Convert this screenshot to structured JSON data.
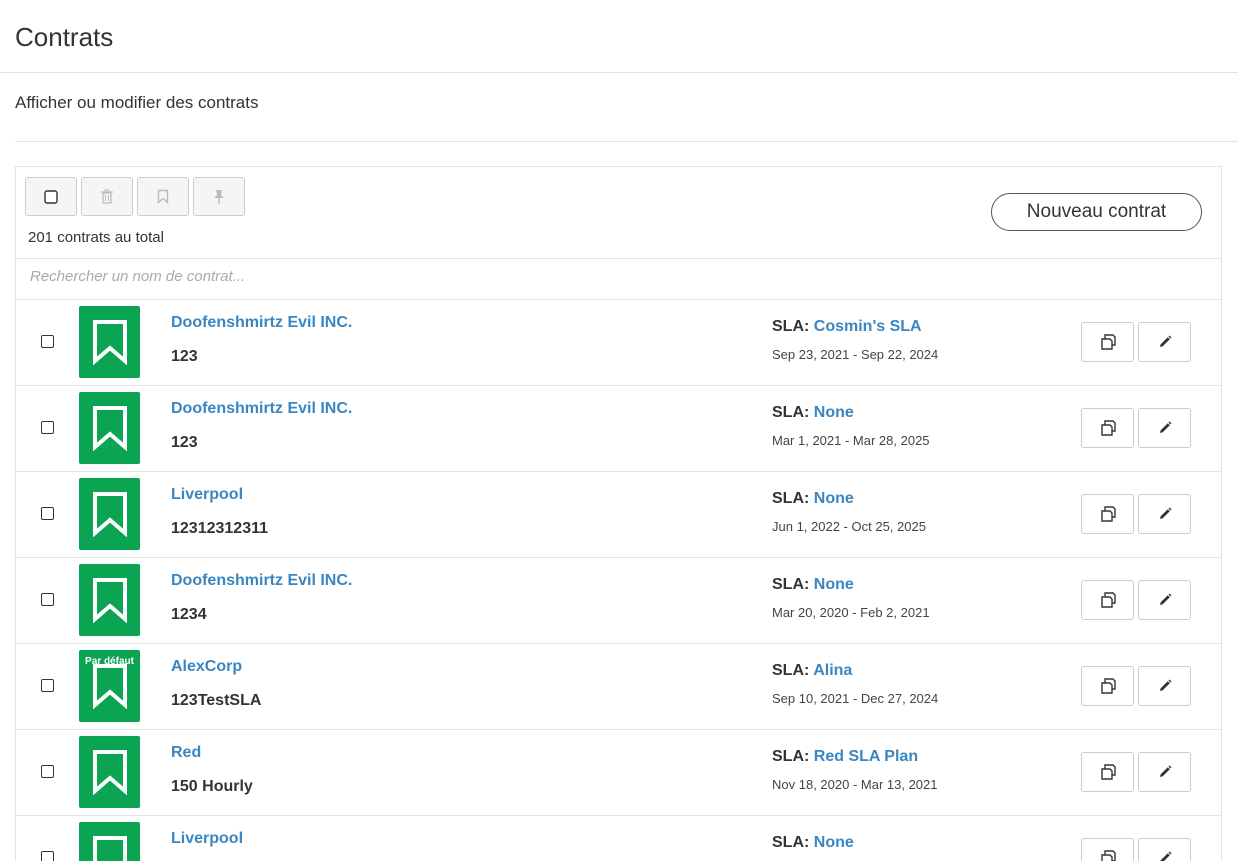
{
  "page": {
    "title": "Contrats",
    "subtitle": "Afficher ou modifier des contrats"
  },
  "toolbar": {
    "total_label": "201 contrats au total",
    "new_button_label": "Nouveau contrat",
    "icons": [
      "checkbox-icon",
      "trash-icon",
      "bookmark-icon",
      "pin-icon"
    ]
  },
  "search": {
    "placeholder": "Rechercher un nom de contrat..."
  },
  "colors": {
    "tile_green": "#0aa453",
    "link_blue": "#3a86c2"
  },
  "contracts": [
    {
      "name": "Doofenshmirtz Evil INC.",
      "code": "123",
      "sla_label": "SLA:",
      "sla_name": "Cosmin's SLA",
      "dates": "Sep 23, 2021 - Sep 22, 2024",
      "badge": ""
    },
    {
      "name": "Doofenshmirtz Evil INC.",
      "code": "123",
      "sla_label": "SLA:",
      "sla_name": "None",
      "dates": "Mar 1, 2021 - Mar 28, 2025",
      "badge": ""
    },
    {
      "name": "Liverpool",
      "code": "12312312311",
      "sla_label": "SLA:",
      "sla_name": "None",
      "dates": "Jun 1, 2022 - Oct 25, 2025",
      "badge": ""
    },
    {
      "name": "Doofenshmirtz Evil INC.",
      "code": "1234",
      "sla_label": "SLA:",
      "sla_name": "None",
      "dates": "Mar 20, 2020 - Feb 2, 2021",
      "badge": ""
    },
    {
      "name": "AlexCorp",
      "code": "123TestSLA",
      "sla_label": "SLA:",
      "sla_name": "Alina",
      "dates": "Sep 10, 2021 - Dec 27, 2024",
      "badge": "Par défaut"
    },
    {
      "name": "Red",
      "code": "150 Hourly",
      "sla_label": "SLA:",
      "sla_name": "Red SLA Plan",
      "dates": "Nov 18, 2020 - Mar 13, 2021",
      "badge": ""
    },
    {
      "name": "Liverpool",
      "code": "",
      "sla_label": "SLA:",
      "sla_name": "None",
      "dates": "",
      "badge": ""
    }
  ]
}
